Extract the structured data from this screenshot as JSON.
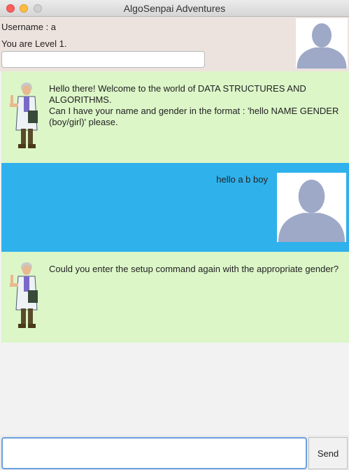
{
  "window": {
    "title": "AlgoSenpai Adventures",
    "controls": [
      "close",
      "minimize",
      "maximize"
    ]
  },
  "header": {
    "username_text": "Username : a",
    "level_text": "You are Level 1.",
    "input_value": "",
    "avatar_icon": "default-user-avatar-icon"
  },
  "messages": [
    {
      "sender": "bot",
      "icon": "professor-sprite-icon",
      "text": "Hello there! Welcome to the world of DATA STRUCTURES AND ALGORITHMS.\nCan I have your name and gender in the format : 'hello NAME GENDER (boy/girl)' please."
    },
    {
      "sender": "user",
      "icon": "default-user-avatar-icon",
      "text": "hello a b boy"
    },
    {
      "sender": "bot",
      "icon": "professor-sprite-icon",
      "text": "Could you enter the setup command again with the appropriate gender?"
    }
  ],
  "footer": {
    "input_value": "",
    "send_label": "Send"
  },
  "colors": {
    "bot_bubble": "#dcf6c8",
    "user_bubble": "#2fb1ec",
    "header_bg": "#ede3de",
    "avatar_silhouette": "#9ea9c7"
  }
}
